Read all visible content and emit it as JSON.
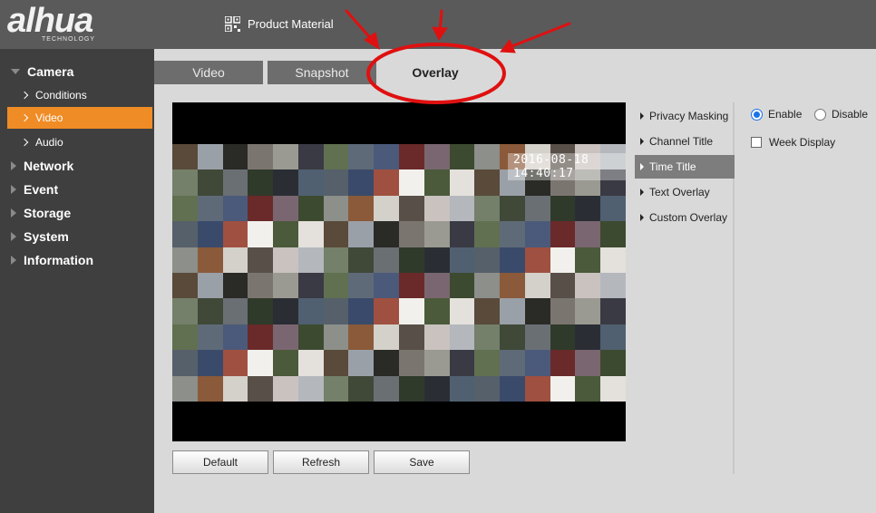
{
  "brand": {
    "logo_text": "alhua",
    "logo_subtext": "TECHNOLOGY"
  },
  "header": {
    "product_label": "Product Material",
    "product_icon": "qr-code-icon"
  },
  "sidebar": {
    "items": [
      {
        "label": "Camera",
        "expanded": true
      },
      {
        "label": "Conditions"
      },
      {
        "label": "Video",
        "selected": true
      },
      {
        "label": "Audio"
      },
      {
        "label": "Network"
      },
      {
        "label": "Event"
      },
      {
        "label": "Storage"
      },
      {
        "label": "System"
      },
      {
        "label": "Information"
      }
    ]
  },
  "tabs": [
    {
      "label": "Video"
    },
    {
      "label": "Snapshot"
    },
    {
      "label": "Overlay",
      "active": true
    }
  ],
  "preview": {
    "time_overlay": "2016-08-18 14:40:17"
  },
  "buttons": {
    "default": "Default",
    "refresh": "Refresh",
    "save": "Save"
  },
  "overlay_list": [
    {
      "label": "Privacy Masking"
    },
    {
      "label": "Channel Title"
    },
    {
      "label": "Time Title",
      "selected": true
    },
    {
      "label": "Text Overlay"
    },
    {
      "label": "Custom Overlay"
    }
  ],
  "settings": {
    "enable_label": "Enable",
    "disable_label": "Disable",
    "enabled": true,
    "week_display_label": "Week Display",
    "week_display_checked": false
  },
  "colors": {
    "accent": "#f08c25",
    "sidebar": "#3f3f3f",
    "topbar": "#5a5a5a",
    "annotation": "#e01010"
  }
}
